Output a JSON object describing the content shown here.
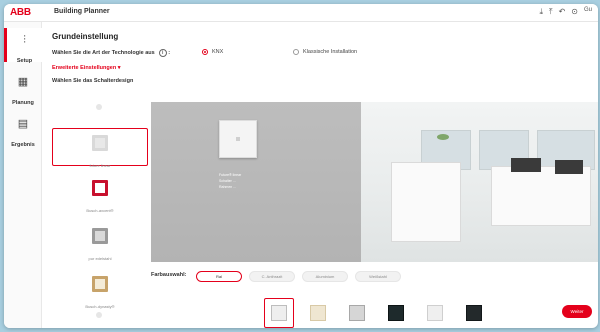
{
  "header": {
    "logo": "ABB",
    "app_title": "Building Planner",
    "user_label": "Gu"
  },
  "nav": [
    {
      "label": "Setup",
      "icon": "sliders-icon"
    },
    {
      "label": "Planung",
      "icon": "floorplan-icon"
    },
    {
      "label": "Ergebnis",
      "icon": "clipboard-icon"
    }
  ],
  "main": {
    "title": "Grundeinstellung",
    "tech_question": "Wählen Sie die Art der Technologie aus",
    "tech_options": [
      {
        "label": "KNX",
        "selected": true
      },
      {
        "label": "Klassische Installation",
        "selected": false
      }
    ],
    "advanced_label": "Erweiterte Einstellungen",
    "design_label": "Wählen Sie das Schalterdesign"
  },
  "switch_designs": [
    {
      "name": "future linear",
      "color": "#e8e8e8",
      "frame": "#d9d9d9",
      "active": true
    },
    {
      "name": "Busch-axcent®",
      "color": "#ffffff",
      "frame": "#c8102e",
      "active": false
    },
    {
      "name": "pur edelstahl",
      "color": "#d9d9d9",
      "frame": "#9a9a9a",
      "active": false
    },
    {
      "name": "Busch-dynasty®",
      "color": "#f4ecd8",
      "frame": "#c7a36a",
      "active": false
    }
  ],
  "preview": {
    "info_lines": [
      "Future® linear",
      "Schalter ...",
      "Rahmen ..."
    ]
  },
  "color_selection": {
    "label": "Farbauswahl:",
    "options": [
      {
        "label": "Ral",
        "selected": true
      },
      {
        "label": "C. Anthrazit",
        "selected": false
      },
      {
        "label": "Aluminium",
        "selected": false
      },
      {
        "label": "Weißstahl",
        "selected": false
      }
    ]
  },
  "swatches": [
    {
      "color": "#eeeeee",
      "border": "#bdbdbd",
      "selected": true
    },
    {
      "color": "#efe6d1",
      "border": "#d8c9a6",
      "selected": false
    },
    {
      "color": "#d6d6d6",
      "border": "#a8a8a8",
      "selected": false
    },
    {
      "color": "#1e2a2c",
      "border": "#0d1415",
      "selected": false
    },
    {
      "color": "#efefef",
      "border": "#cfcfcf",
      "selected": false
    },
    {
      "color": "#23292b",
      "border": "#121719",
      "selected": false
    }
  ],
  "actions": {
    "next_label": "Weiter"
  }
}
